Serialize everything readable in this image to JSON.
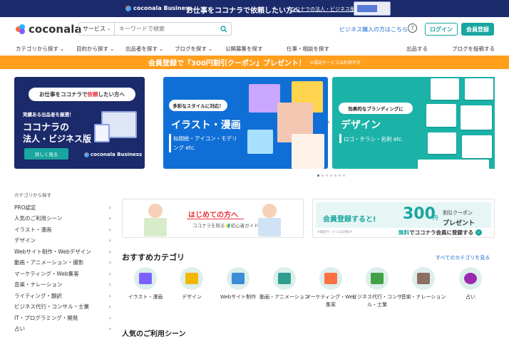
{
  "promo": {
    "logo": "coconala Business",
    "title": "お仕事をココナラで依頼したい方へ",
    "link": "ココナラの法人・ビジネス版"
  },
  "header": {
    "logo": "coconala",
    "search_service": "サービス",
    "search_placeholder": "キーワードで検索",
    "business_link": "ビジネス購入の方はこちら",
    "help": "?",
    "login": "ログイン",
    "signup": "会員登録"
  },
  "nav": [
    {
      "label": "カテゴリから探す",
      "chev": true
    },
    {
      "label": "目的から探す",
      "chev": true
    },
    {
      "label": "出品者を探す",
      "chev": true
    },
    {
      "label": "ブログを探す",
      "chev": true
    },
    {
      "label": "公開募集を探す",
      "chev": false
    },
    {
      "label": "仕事・相談を探す",
      "chev": false
    },
    {
      "label": "出品する",
      "chev": false
    },
    {
      "label": "ブログを投稿する",
      "chev": false
    }
  ],
  "coupon": {
    "text": "会員登録で『300円割引クーポン』プレゼント！",
    "note": "※電話サービスは利用不可"
  },
  "carousel": {
    "slide1": {
      "tag_prefix": "お仕事をココナラで",
      "tag_emph": "依頼",
      "tag_suffix": "したい方へ",
      "sub": "実績ある出品者を厳選！",
      "h1": "ココナラの",
      "h2": "法人・ビジネス版",
      "button": "詳しく見る",
      "logo": "coconala Business"
    },
    "slide2": {
      "tag": "多彩なスタイルに対応！",
      "title": "イラスト・漫画",
      "sub": "似顔絵・アイコン・モデリング etc."
    },
    "slide3": {
      "tag": "効果的なブランディングに",
      "title": "デザイン",
      "sub": "ロゴ・チラシ・名刺 etc."
    },
    "prev": "‹",
    "next": "›",
    "dots": 7,
    "active_dot": 0
  },
  "sidebar": {
    "title": "カテゴリから探す",
    "items": [
      "PRO認定",
      "人気のご利用シーン",
      "イラスト・漫画",
      "デザイン",
      "Webサイト制作・Webデザイン",
      "動画・アニメーション・撮影",
      "マーケティング・Web集客",
      "音楽・ナレーション",
      "ライティング・翻訳",
      "ビジネス代行・コンサル・士業",
      "IT・プログラミング・開発",
      "占い"
    ]
  },
  "banner_first": {
    "title": "はじめての方へ",
    "sub": "ココナラを知る🔰初心者ガイド"
  },
  "banner_coupon": {
    "register": "会員登録すると!",
    "amount": "300",
    "yen": "円",
    "coupon1": "割引クーポン",
    "coupon2": "プレゼント",
    "note": "※電話サービスは対象外",
    "cta_emph": "無料",
    "cta": "でココナラ会員に登録する",
    "cta_icon": "›"
  },
  "recommended": {
    "title": "おすすめカテゴリ",
    "see_all": "すべてのカテゴリを見る",
    "categories": [
      {
        "label": "イラスト・漫画",
        "color": "#7b61ff"
      },
      {
        "label": "デザイン",
        "color": "#f2b705"
      },
      {
        "label": "Webサイト制作",
        "color": "#3d8bd9"
      },
      {
        "label": "動画・アニメーション",
        "color": "#2f9e8f"
      },
      {
        "label": "マーケティング・Web集客",
        "color": "#ff7043"
      },
      {
        "label": "ビジネス代行・コンサル・士業",
        "color": "#43a047"
      },
      {
        "label": "音楽・ナレーション",
        "color": "#8d6e63"
      },
      {
        "label": "占い",
        "color": "#9c27b0"
      }
    ]
  },
  "popular_title": "人気のご利用シーン",
  "colors": {
    "navy": "#1b2a6b",
    "teal": "#19a6a0",
    "orange": "#ff9f1c",
    "link": "#1b6ed1"
  }
}
